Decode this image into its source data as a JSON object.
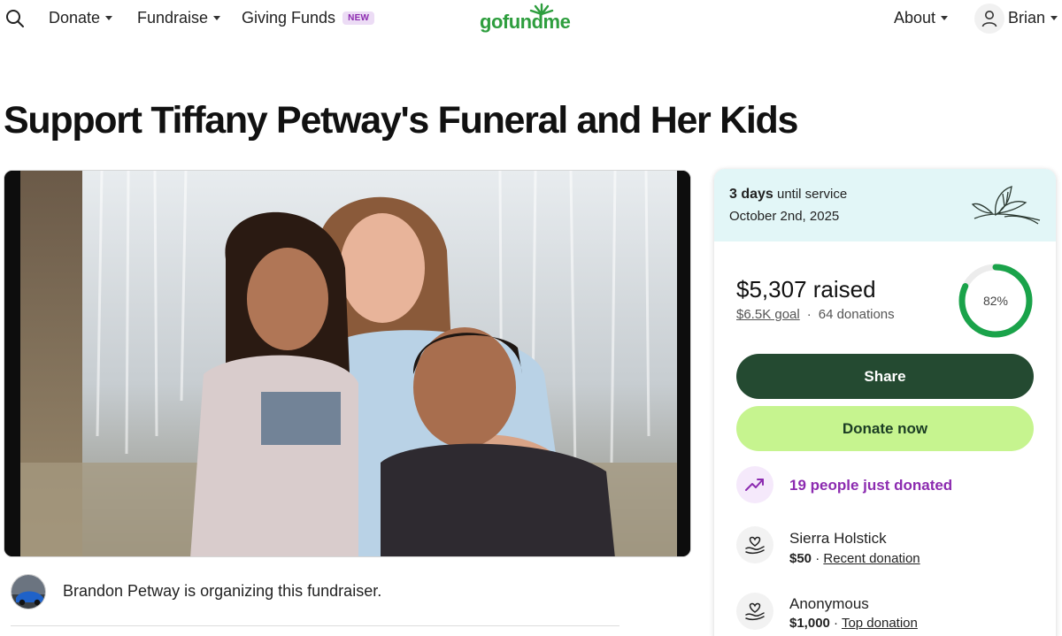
{
  "header": {
    "nav": {
      "donate": "Donate",
      "fundraise": "Fundraise",
      "giving_funds": "Giving Funds",
      "giving_funds_badge": "NEW",
      "about": "About",
      "user": "Brian"
    },
    "logo_text": "gofundme"
  },
  "campaign": {
    "title": "Support Tiffany Petway's Funeral and Her Kids",
    "organizer_text": "Brandon Petway is organizing this fundraiser."
  },
  "card": {
    "service": {
      "days": "3 days",
      "until": "until service",
      "date": "October 2nd, 2025"
    },
    "raised": "$5,307 raised",
    "goal": "$6.5K goal",
    "separator": "·",
    "donations": "64 donations",
    "progress_percent": 82,
    "progress_label": "82%",
    "share_label": "Share",
    "donate_label": "Donate now",
    "trend_text": "19 people just donated",
    "donors": [
      {
        "name": "Sierra Holstick",
        "amount": "$50",
        "sep": " · ",
        "tag": "Recent donation"
      },
      {
        "name": "Anonymous",
        "amount": "$1,000",
        "sep": " · ",
        "tag": "Top donation"
      }
    ]
  },
  "colors": {
    "brand_green": "#2e9e3e",
    "share_button": "#244a31",
    "donate_button": "#c6f48f",
    "progress_ring": "#1aa34a",
    "trend_purple": "#8c2bb0",
    "service_banner": "#e2f6f7"
  },
  "icons": {
    "search": "search-icon",
    "user": "user-icon",
    "trend": "trending-up-icon",
    "donor": "heart-hand-icon",
    "lily": "lily-flower-icon"
  }
}
